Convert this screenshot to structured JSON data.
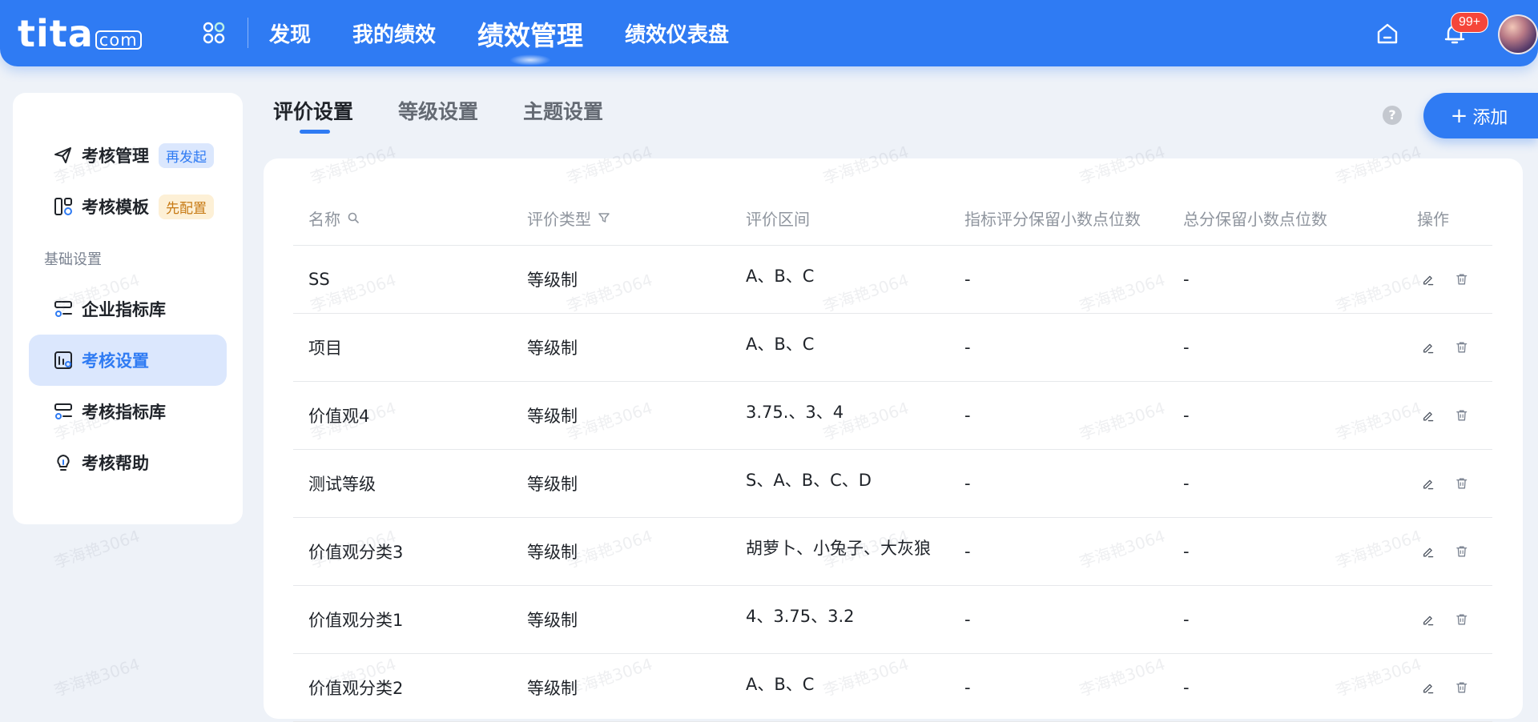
{
  "brand": {
    "logo_main": "tita",
    "logo_suffix": "com",
    "accent": "#2f7bf3"
  },
  "topnav": {
    "items": [
      {
        "label": "发现"
      },
      {
        "label": "我的绩效"
      },
      {
        "label": "绩效管理"
      },
      {
        "label": "绩效仪表盘"
      }
    ],
    "active_index": 2,
    "notification_badge": "99+"
  },
  "sidebar": {
    "items": [
      {
        "label": "考核管理",
        "tag": "再发起",
        "icon": "send-icon"
      },
      {
        "label": "考核模板",
        "tag": "先配置",
        "icon": "template-icon"
      }
    ],
    "section_label": "基础设置",
    "settings_items": [
      {
        "label": "企业指标库",
        "icon": "indicator-library-icon"
      },
      {
        "label": "考核设置",
        "icon": "settings-chart-icon"
      },
      {
        "label": "考核指标库",
        "icon": "indicator-list-icon"
      },
      {
        "label": "考核帮助",
        "icon": "lightbulb-icon"
      }
    ],
    "active_item": "考核设置"
  },
  "tabs": {
    "items": [
      {
        "label": "评价设置"
      },
      {
        "label": "等级设置"
      },
      {
        "label": "主题设置"
      }
    ],
    "active_index": 0
  },
  "actions": {
    "help_label": "?",
    "add_label": "添加"
  },
  "table": {
    "columns": [
      "名称",
      "评价类型",
      "评价区间",
      "指标评分保留小数点位数",
      "总分保留小数点位数",
      "操作"
    ],
    "rows": [
      {
        "name": "SS",
        "type": "等级制",
        "range": "A、B、C",
        "indicator_decimals": "-",
        "total_decimals": "-"
      },
      {
        "name": "项目",
        "type": "等级制",
        "range": "A、B、C",
        "indicator_decimals": "-",
        "total_decimals": "-"
      },
      {
        "name": "价值观4",
        "type": "等级制",
        "range": "3.75.、3、4",
        "indicator_decimals": "-",
        "total_decimals": "-"
      },
      {
        "name": "测试等级",
        "type": "等级制",
        "range": "S、A、B、C、D",
        "indicator_decimals": "-",
        "total_decimals": "-"
      },
      {
        "name": "价值观分类3",
        "type": "等级制",
        "range": "胡萝卜、小兔子、大灰狼",
        "indicator_decimals": "-",
        "total_decimals": "-"
      },
      {
        "name": "价值观分类1",
        "type": "等级制",
        "range": "4、3.75、3.2",
        "indicator_decimals": "-",
        "total_decimals": "-"
      },
      {
        "name": "价值观分类2",
        "type": "等级制",
        "range": "A、B、C",
        "indicator_decimals": "-",
        "total_decimals": "-"
      }
    ]
  },
  "watermark_text": "李海艳3064"
}
